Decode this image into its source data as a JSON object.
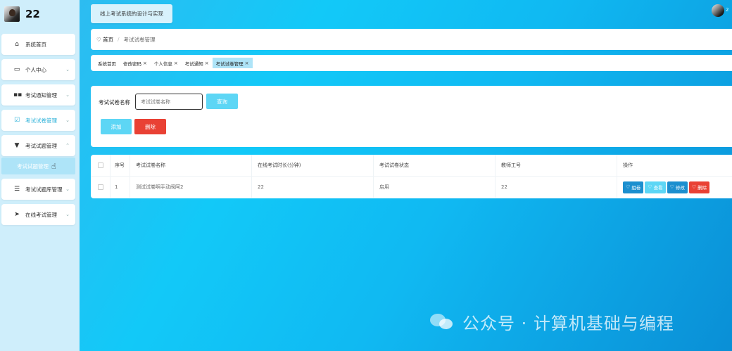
{
  "user": {
    "name": "22"
  },
  "header": {
    "site_title": "线上考试系统的设计与实现",
    "top_user": "2"
  },
  "sidebar": {
    "items": [
      {
        "label": "系统首页",
        "icon": "home-icon",
        "chevron": ""
      },
      {
        "label": "个人中心",
        "icon": "card-icon",
        "chevron": "⌄"
      },
      {
        "label": "考试通知管理",
        "icon": "grid-icon",
        "chevron": "⌄"
      },
      {
        "label": "考试试卷管理",
        "icon": "checkbox-icon",
        "chevron": "⌄"
      },
      {
        "label": "考试试题管理",
        "icon": "stamp-icon",
        "chevron": "⌃"
      },
      {
        "label": "考试试题库管理",
        "icon": "list-icon",
        "chevron": "⌄"
      },
      {
        "label": "在线考试管理",
        "icon": "send-icon",
        "chevron": "⌄"
      }
    ],
    "subitem": "考试试题管理"
  },
  "breadcrumb": {
    "home": "首页",
    "separator": "/",
    "current": "考试试卷管理"
  },
  "tabs": [
    {
      "label": "系统首页",
      "closable": false
    },
    {
      "label": "修改密码",
      "closable": true
    },
    {
      "label": "个人信息",
      "closable": true
    },
    {
      "label": "考试通知",
      "closable": true
    },
    {
      "label": "考试试卷管理",
      "closable": true
    }
  ],
  "search": {
    "label": "考试试卷名称",
    "placeholder": "考试试卷名称",
    "query_button": "查询",
    "add_button": "添加",
    "delete_button": "删除"
  },
  "table": {
    "columns": [
      "序号",
      "考试试卷名称",
      "在线考试时长(分钟)",
      "考试试卷状态",
      "教师工号",
      "操作"
    ],
    "rows": [
      {
        "index": "1",
        "name": "测试试卷啊手动阀阿2",
        "duration": "22",
        "status": "启用",
        "teacher_id": "22"
      }
    ],
    "actions": [
      {
        "label": "组卷",
        "color": "#1c8fcf"
      },
      {
        "label": "查看",
        "color": "#5dd6f5"
      },
      {
        "label": "修改",
        "color": "#1c8fcf"
      },
      {
        "label": "删除",
        "color": "#e94134"
      }
    ]
  },
  "watermark": "公众号 · 计算机基础与编程",
  "colors": {
    "accent": "#5dd6f5",
    "danger": "#e94134",
    "primary": "#1c8fcf"
  }
}
